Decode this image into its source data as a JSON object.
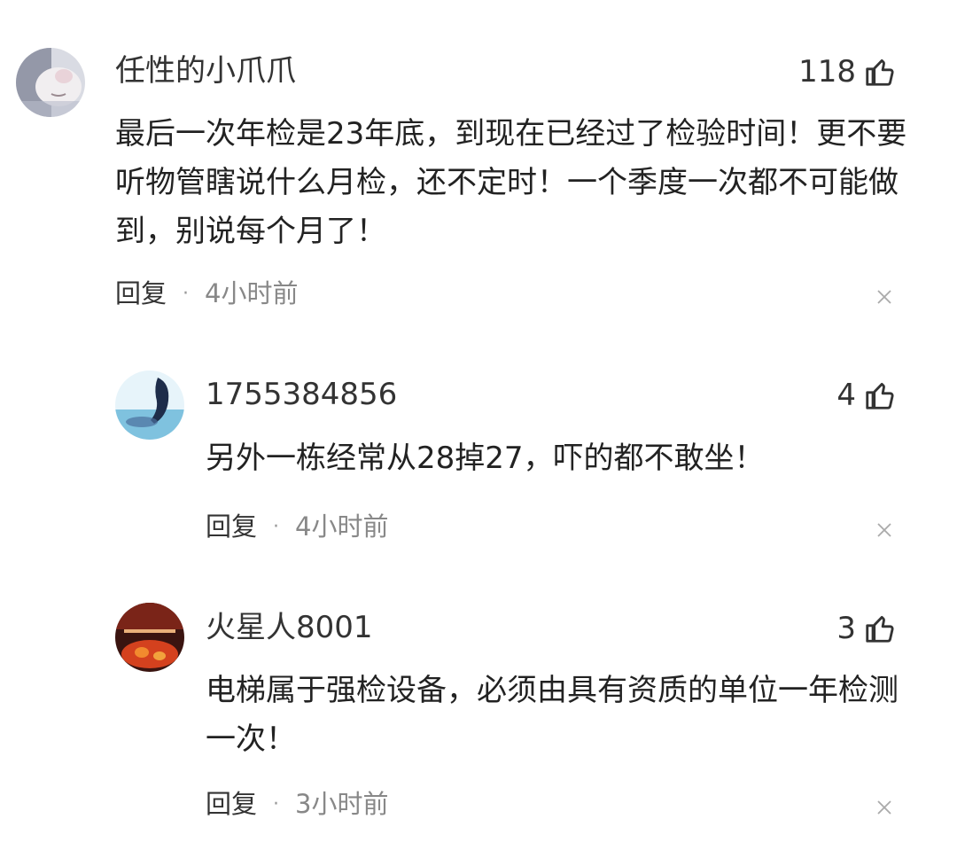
{
  "comments": [
    {
      "username": "任性的小爪爪",
      "likes": "118",
      "text": "最后一次年检是23年底，到现在已经过了检验时间！更不要听物管瞎说什么月检，还不定时！一个季度一次都不可能做到，别说每个月了！",
      "reply_label": "回复",
      "separator": "·",
      "time": "4小时前",
      "avatar_icon": "avatar-cat-icon",
      "avatar_color": "#c9ccd6"
    },
    {
      "username": "1755384856",
      "likes": "4",
      "text": "另外一栋经常从28掉27，吓的都不敢坐！",
      "reply_label": "回复",
      "separator": "·",
      "time": "4小时前",
      "avatar_icon": "avatar-figure-icon",
      "avatar_color": "#9fd0e8"
    },
    {
      "username": "火星人8001",
      "likes": "3",
      "text": "电梯属于强检设备，必须由具有资质的单位一年检测一次！",
      "reply_label": "回复",
      "separator": "·",
      "time": "3小时前",
      "avatar_icon": "avatar-fire-icon",
      "avatar_color": "#8a2a1e"
    }
  ],
  "icons": {
    "like": "thumbs-up-icon",
    "close": "close-icon"
  }
}
